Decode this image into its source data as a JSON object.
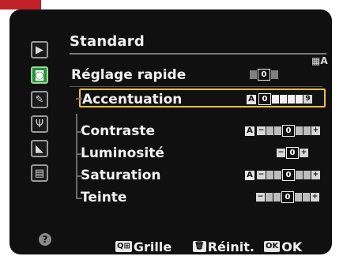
{
  "screen": {
    "title": "Standard",
    "picture_control_icon": "picture-control-icon",
    "picture_control_code": "A",
    "menu": {
      "quick_adjust_label": "Réglage rapide",
      "quick_adjust_value": "0",
      "items": [
        {
          "label": "Accentuation",
          "left_cap": "A",
          "value": "0",
          "right_value": "9",
          "active": true
        },
        {
          "label": "Contraste",
          "left_cap": "A",
          "value": "0",
          "active": false
        },
        {
          "label": "Luminosité",
          "left_cap": "",
          "value": "0",
          "active": false
        },
        {
          "label": "Saturation",
          "left_cap": "A",
          "value": "0",
          "active": false
        },
        {
          "label": "Teinte",
          "left_cap": "",
          "value": "0",
          "active": false
        }
      ]
    },
    "bottom_hints": [
      {
        "key": "Q⊞",
        "label": "Grille",
        "icon": "grid-icon"
      },
      {
        "key": "🗑",
        "label": "Réinit.",
        "icon": "trash-icon"
      },
      {
        "key": "OK",
        "label": "OK",
        "icon": "ok-icon"
      }
    ],
    "sidebar_icons": [
      "playback-icon",
      "camera-icon",
      "pencil-icon",
      "wrench-icon",
      "retouch-icon",
      "recent-settings-icon"
    ],
    "help_glyph": "?"
  },
  "colors": {
    "background": "#101010",
    "text": "#f0f0f0",
    "highlight": "#e8c23a",
    "active_sidebar": "#2a8f3c",
    "red_tab": "#c0202a"
  }
}
